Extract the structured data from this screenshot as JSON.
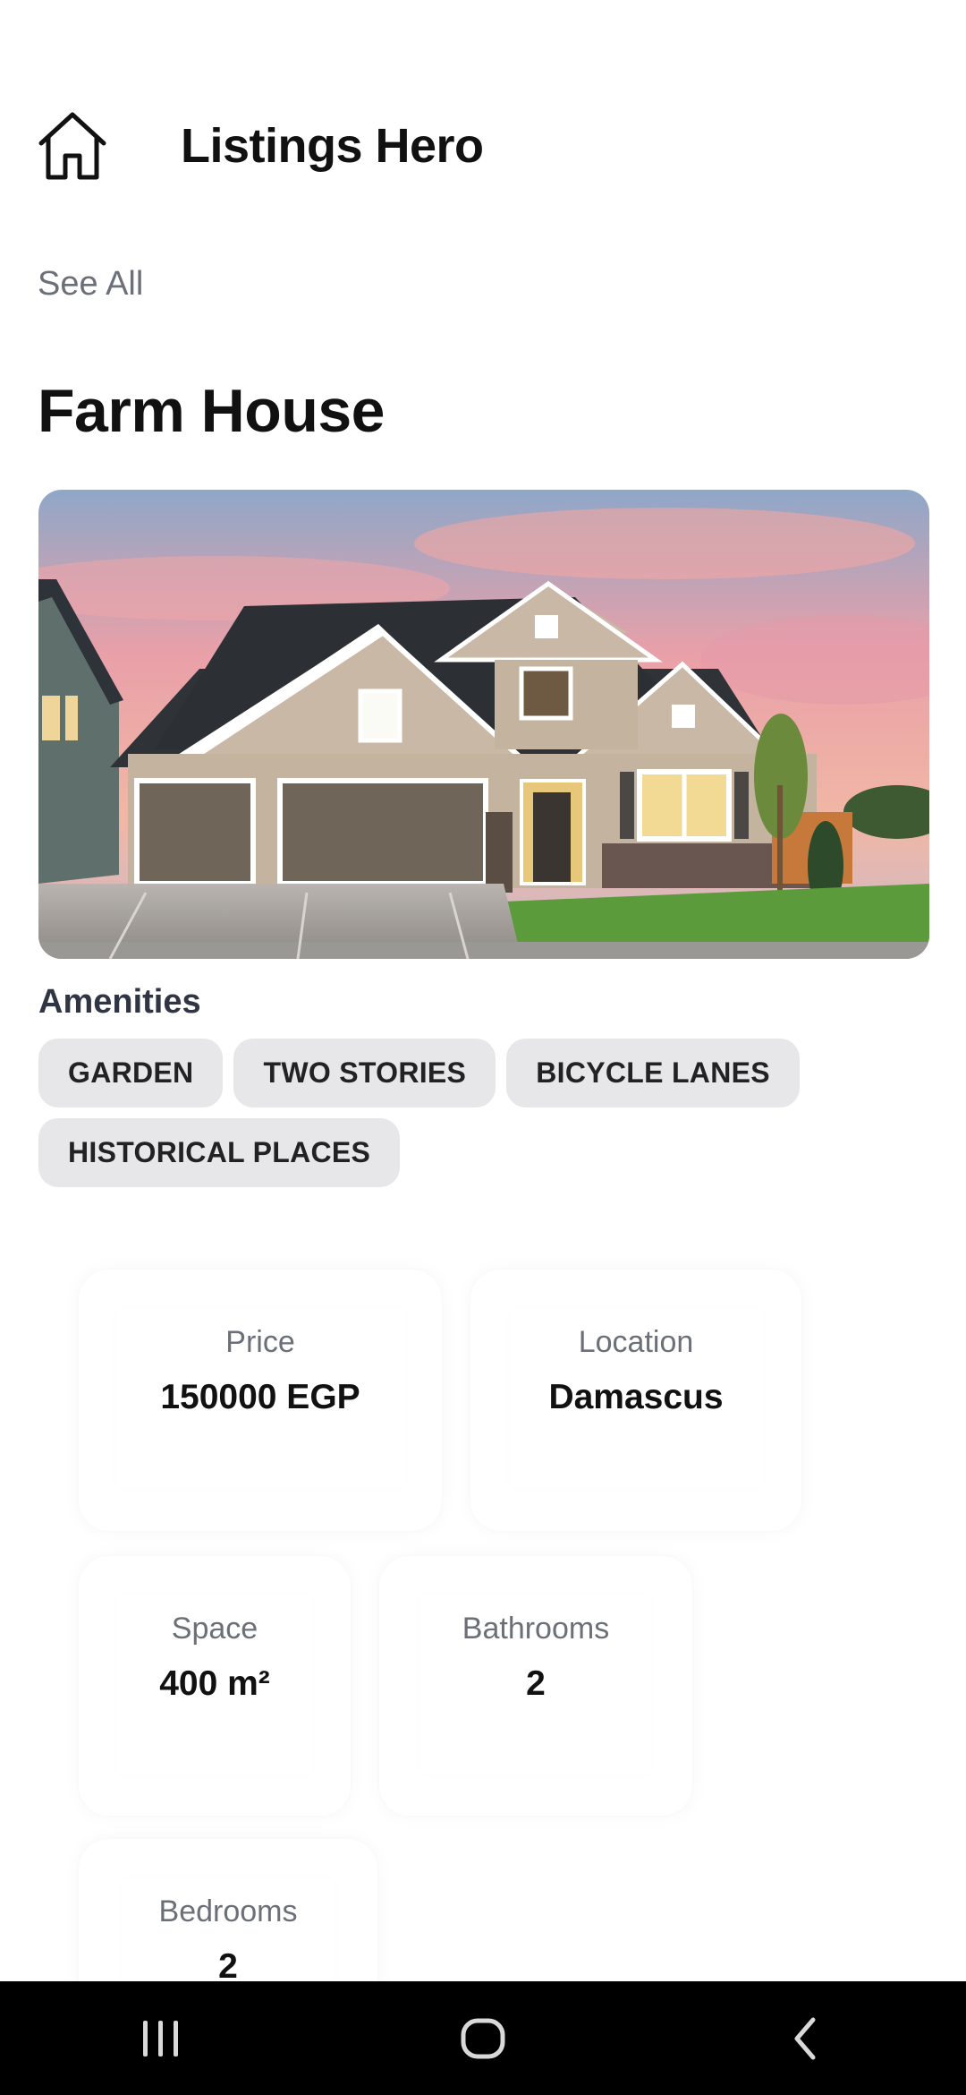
{
  "header": {
    "icon": "home-icon",
    "title": "Listings Hero"
  },
  "see_all_label": "See All",
  "listing": {
    "title": "Farm House",
    "photo_icon": "house-photo",
    "amenities_label": "Amenities",
    "amenities": [
      "GARDEN",
      "TWO STORIES",
      "BICYCLE LANES",
      "HISTORICAL PLACES"
    ],
    "stats": {
      "price": {
        "label": "Price",
        "value": "150000 EGP"
      },
      "location": {
        "label": "Location",
        "value": "Damascus"
      },
      "space": {
        "label": "Space",
        "value": "400 m²"
      },
      "bathrooms": {
        "label": "Bathrooms",
        "value": "2"
      },
      "bedrooms": {
        "label": "Bedrooms",
        "value": "2"
      }
    }
  },
  "system_nav": {
    "recents_icon": "recents-icon",
    "home_icon": "home-circle-icon",
    "back_icon": "back-icon"
  },
  "colors": {
    "chip_bg": "#e7e7ea",
    "muted_text": "#6b7078",
    "nav_bar": "#000000"
  }
}
